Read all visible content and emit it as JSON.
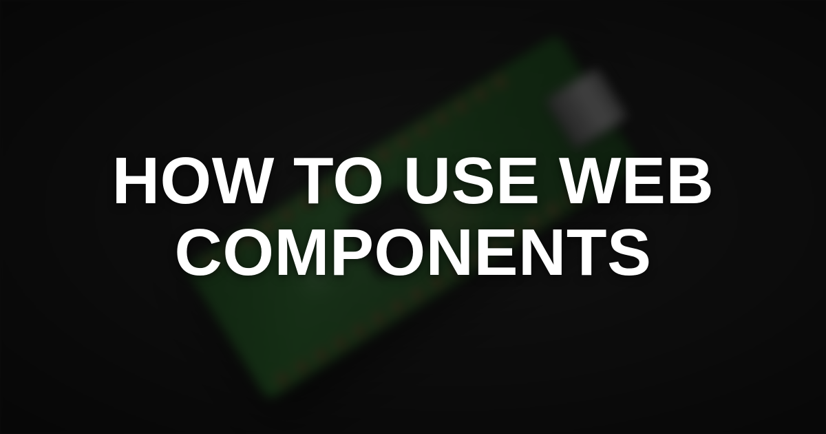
{
  "title": "HOW TO USE WEB\nCOMPONENTS",
  "colors": {
    "text": "#ffffff",
    "board": "#3a9a3a",
    "background": "#1a1a1a"
  },
  "background_subject": "microcontroller-board"
}
